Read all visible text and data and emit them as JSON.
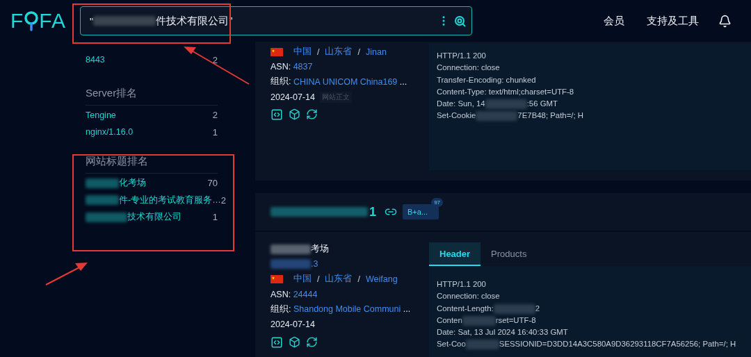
{
  "header": {
    "logo": {
      "left": "F",
      "right": "FA"
    },
    "search": {
      "value_start": "\"",
      "value_end": "件技术有限公司\""
    },
    "nav": [
      {
        "label": "会员"
      },
      {
        "label": "支持及工具"
      }
    ]
  },
  "sidebar": {
    "sections": [
      {
        "items": [
          {
            "label": "8443",
            "count": "2",
            "redacted": false
          }
        ]
      },
      {
        "title": "Server排名",
        "items": [
          {
            "label": "Tengine",
            "count": "2",
            "redacted": false
          },
          {
            "label": "nginx/1.16.0",
            "count": "1",
            "redacted": false
          }
        ]
      },
      {
        "title": "网站标题排名",
        "items": [
          {
            "label": "化考场",
            "count": "70",
            "redacted": true
          },
          {
            "label": "件-专业的考试教育服务…",
            "count": "2",
            "redacted": true
          },
          {
            "label": "技术有限公司",
            "count": "1",
            "redacted": true
          }
        ]
      }
    ]
  },
  "tooltip": "网站正文",
  "location_sep": "/",
  "results": [
    {
      "location": [
        "中国",
        "山东省",
        "Jinan"
      ],
      "asn_label": "ASN:",
      "asn": "4837",
      "org_label": "组织:",
      "org": "CHINA UNICOM China169",
      "org_more": "...",
      "date": "2024-07-14",
      "header_lines": [
        [
          "HTTP/1.1 200"
        ],
        [
          "Connection: close"
        ],
        [
          "Transfer-Encoding: chunked"
        ],
        [
          "Content-Type: text/html;charset=UTF-8"
        ],
        [
          "Date: Sun, 14",
          ":56 GMT"
        ],
        [
          "Set-Cookie",
          "7E7B48; Path=/; H"
        ]
      ]
    },
    {
      "ip": "1",
      "tag": "B+a...",
      "tag_count": "97",
      "site_title": "考场",
      "host": ".3",
      "tabs": [
        {
          "label": "Header",
          "selected": true
        },
        {
          "label": "Products",
          "selected": false
        }
      ],
      "location": [
        "中国",
        "山东省",
        "Weifang"
      ],
      "asn_label": "ASN:",
      "asn": "24444",
      "org_label": "组织:",
      "org": "Shandong Mobile Communi",
      "org_more": "...",
      "date": "2024-07-14",
      "header_lines": [
        [
          "HTTP/1.1 200"
        ],
        [
          "Connection: close"
        ],
        [
          "Content-Length:",
          "2"
        ],
        [
          "Conten",
          "rset=UTF-8"
        ],
        [
          "Date: Sat, 13 Jul 2024 16:40:33 GMT"
        ],
        [
          "Set-Coo",
          "SESSIONID=D3DD14A3C580A9D36293118CF7A56256; Path=/; H"
        ]
      ]
    }
  ]
}
